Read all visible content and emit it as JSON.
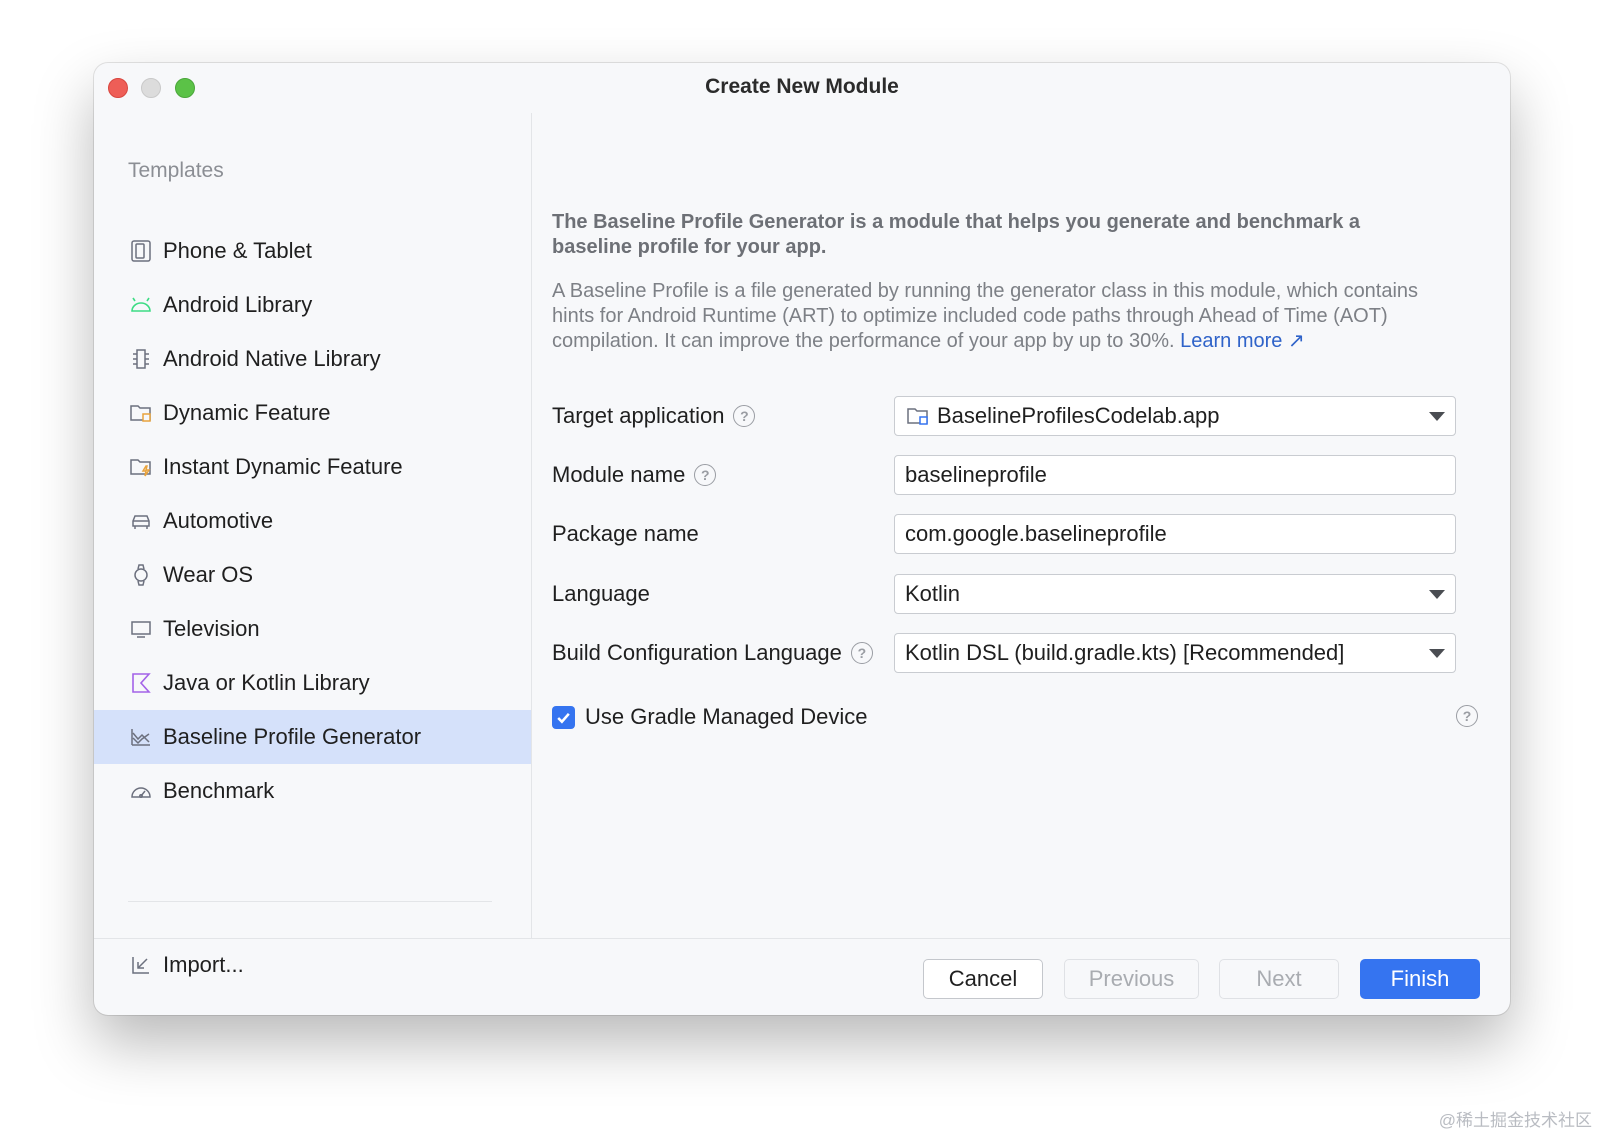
{
  "window": {
    "title": "Create New Module"
  },
  "sidebar": {
    "heading": "Templates",
    "items": [
      {
        "label": "Phone & Tablet",
        "icon": "phone-tablet-icon"
      },
      {
        "label": "Android Library",
        "icon": "android-icon"
      },
      {
        "label": "Android Native Library",
        "icon": "native-chip-icon"
      },
      {
        "label": "Dynamic Feature",
        "icon": "dynamic-feature-folder-icon"
      },
      {
        "label": "Instant Dynamic Feature",
        "icon": "instant-feature-folder-icon"
      },
      {
        "label": "Automotive",
        "icon": "car-icon"
      },
      {
        "label": "Wear OS",
        "icon": "watch-icon"
      },
      {
        "label": "Television",
        "icon": "tv-icon"
      },
      {
        "label": "Java or Kotlin Library",
        "icon": "kotlin-icon"
      },
      {
        "label": "Baseline Profile Generator",
        "icon": "baseline-chart-icon",
        "selected": true
      },
      {
        "label": "Benchmark",
        "icon": "gauge-icon"
      }
    ],
    "import_label": "Import..."
  },
  "main": {
    "description_bold": "The Baseline Profile Generator is a module that helps you generate and benchmark a baseline profile for your app.",
    "description": "A Baseline Profile is a file generated by running the generator class in this module, which contains hints for Android Runtime (ART) to optimize included code paths through Ahead of Time (AOT) compilation. It can improve the performance of your app by up to 30%.",
    "learn_more": "Learn more",
    "learn_more_arrow": "↗",
    "fields": {
      "target_application": {
        "label": "Target application",
        "value": "BaselineProfilesCodelab.app"
      },
      "module_name": {
        "label": "Module name",
        "value": "baselineprofile"
      },
      "package_name": {
        "label": "Package name",
        "value": "com.google.baselineprofile"
      },
      "language": {
        "label": "Language",
        "value": "Kotlin"
      },
      "build_config_language": {
        "label": "Build Configuration Language",
        "value": "Kotlin DSL (build.gradle.kts) [Recommended]"
      }
    },
    "gradle_managed_device": {
      "label": "Use Gradle Managed Device",
      "checked": true
    },
    "help_glyph": "?"
  },
  "footer": {
    "cancel": "Cancel",
    "previous": "Previous",
    "next": "Next",
    "finish": "Finish"
  },
  "watermark": "@稀土掘金技术社区",
  "colors": {
    "accent": "#3574f0",
    "selection": "#d5e1fa",
    "link": "#2f63c9"
  }
}
